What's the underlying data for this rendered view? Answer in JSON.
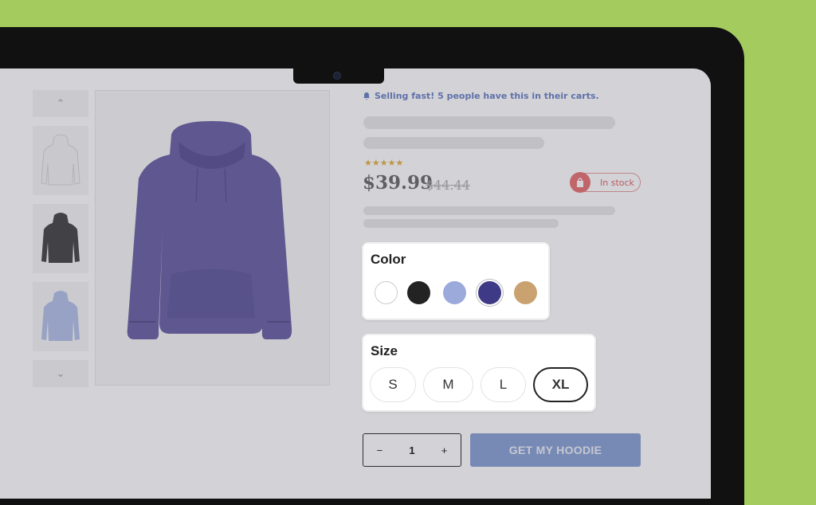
{
  "product": {
    "alert_text": "Selling fast! 5 people have this in their carts.",
    "rating_stars": "★★★★★",
    "price": "$39.99",
    "old_price": "$44.44",
    "stock_status": "In stock"
  },
  "gallery": {
    "up_arrow": "⌃",
    "down_arrow": "⌄",
    "thumbnails": [
      "white-hoodie",
      "black-hoodie",
      "light-blue-hoodie"
    ],
    "main_image": "purple-hoodie"
  },
  "color_picker": {
    "title": "Color",
    "swatches": [
      {
        "color": "#ffffff",
        "selected": false
      },
      {
        "color": "#232323",
        "selected": false
      },
      {
        "color": "#9ba9db",
        "selected": false
      },
      {
        "color": "#3f3a86",
        "selected": true
      },
      {
        "color": "#c9a270",
        "selected": false
      }
    ]
  },
  "size_picker": {
    "title": "Size",
    "options": [
      "S",
      "M",
      "L",
      "XL"
    ],
    "selected": "XL"
  },
  "cart": {
    "decrement": "−",
    "quantity": "1",
    "increment": "+",
    "cta_label": "GET MY HOODIE"
  }
}
